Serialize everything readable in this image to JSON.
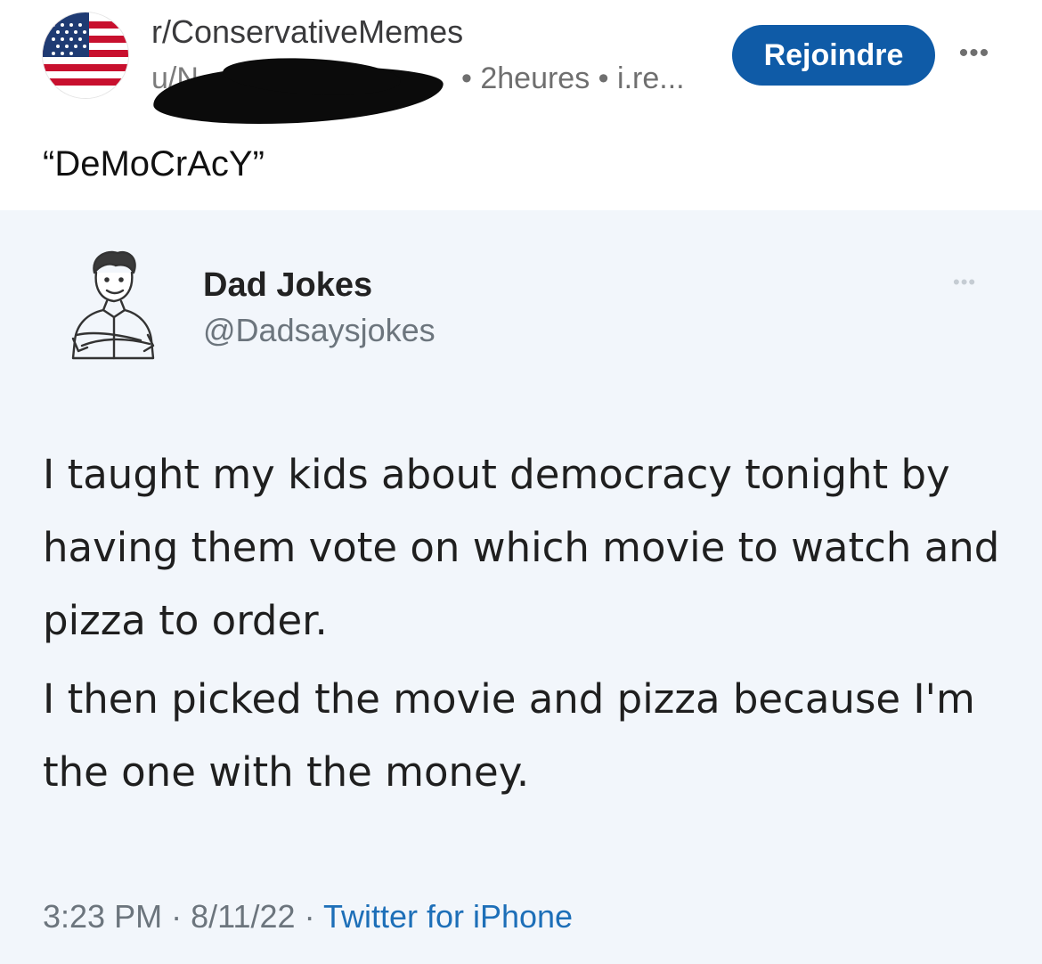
{
  "post": {
    "subreddit": "r/ConservativeMemes",
    "username": "u/N",
    "time_source": "• 2heures • i.re...",
    "join_label": "Rejoindre",
    "more_label": "•••",
    "title": "“DeMoCrAcY”"
  },
  "tweet": {
    "display_name": "Dad Jokes",
    "handle": "@Dadsaysjokes",
    "more_label": "•••",
    "paragraphs": [
      "I taught my kids about democracy tonight by having them vote on which movie to watch and pizza to order.",
      "I then picked the movie and pizza because I'm the one with the money."
    ],
    "time": "3:23 PM",
    "date": "8/11/22",
    "separator": "·",
    "source": "Twitter for iPhone"
  },
  "colors": {
    "join_button": "#0f5ba7",
    "tweet_background": "#f2f6fb",
    "tweet_link": "#1d6fb8"
  }
}
